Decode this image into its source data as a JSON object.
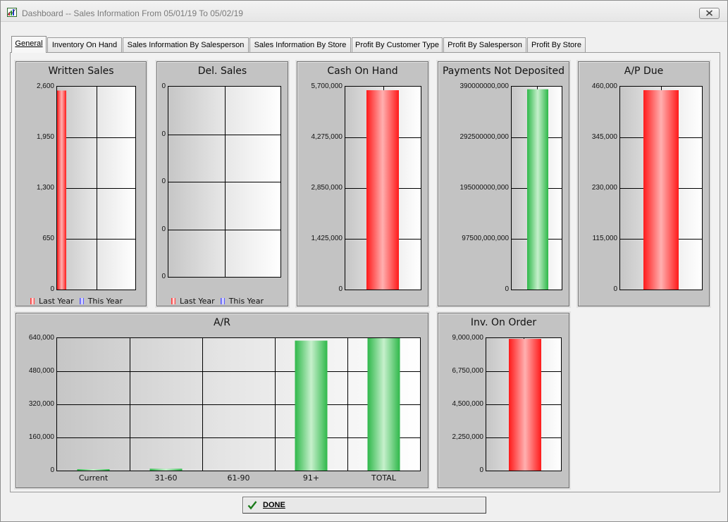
{
  "window": {
    "title": "Dashboard -- Sales Information From 05/01/19 To 05/02/19",
    "app_icon": "chart-icon",
    "close_icon": "close-icon"
  },
  "tabs": [
    {
      "label": "General",
      "active": true
    },
    {
      "label": "Inventory On Hand",
      "active": false
    },
    {
      "label": "Sales Information By Salesperson",
      "active": false
    },
    {
      "label": "Sales Information By Store",
      "active": false
    },
    {
      "label": "Profit By Customer Type",
      "active": false
    },
    {
      "label": "Profit By Salesperson",
      "active": false
    },
    {
      "label": "Profit By Store",
      "active": false
    }
  ],
  "colors": {
    "red_bar": "#ff1a1a",
    "green_bar": "#2fb84a",
    "blue_legend": "#3a3aff",
    "panel_bg": "#c3c3c3"
  },
  "done_button": {
    "label": "DONE",
    "icon": "checkmark-icon"
  },
  "chart_data": [
    {
      "id": "written",
      "type": "bar",
      "title": "Written Sales",
      "yticks": [
        "0",
        "650",
        "1,300",
        "1,950",
        "2,600"
      ],
      "ylim": [
        0,
        2600
      ],
      "categories": [
        ""
      ],
      "series": [
        {
          "name": "Last Year",
          "color": "red",
          "values": [
            2550
          ]
        },
        {
          "name": "This Year",
          "color": "blue",
          "values": [
            0
          ]
        }
      ],
      "legend": [
        "Last Year",
        "This Year"
      ],
      "grid": true,
      "legend_position": "bottom"
    },
    {
      "id": "delsales",
      "type": "bar",
      "title": "Del. Sales",
      "yticks": [
        "0",
        "0",
        "0",
        "0",
        "0"
      ],
      "ylim": [
        0,
        0
      ],
      "categories": [
        ""
      ],
      "series": [
        {
          "name": "Last Year",
          "color": "red",
          "values": [
            0
          ]
        },
        {
          "name": "This Year",
          "color": "blue",
          "values": [
            0
          ]
        }
      ],
      "legend": [
        "Last Year",
        "This Year"
      ],
      "grid": true,
      "legend_position": "bottom"
    },
    {
      "id": "cash",
      "type": "bar",
      "title": "Cash On Hand",
      "yticks": [
        "0",
        "1,425,000",
        "2,850,000",
        "4,275,000",
        "5,700,000"
      ],
      "ylim": [
        0,
        5700000
      ],
      "categories": [
        ""
      ],
      "series": [
        {
          "color": "red",
          "values": [
            5600000
          ]
        }
      ],
      "grid": true
    },
    {
      "id": "payments",
      "type": "bar",
      "title": "Payments Not Deposited",
      "yticks": [
        "0",
        "97500,000,000",
        "195000000,000",
        "292500000,000",
        "390000000,000"
      ],
      "ylim": [
        0,
        390000000000
      ],
      "categories": [
        ""
      ],
      "series": [
        {
          "color": "green",
          "values": [
            385000000000
          ]
        }
      ],
      "grid": true
    },
    {
      "id": "ap",
      "type": "bar",
      "title": "A/P Due",
      "yticks": [
        "0",
        "115,000",
        "230,000",
        "345,000",
        "460,000"
      ],
      "ylim": [
        0,
        460000
      ],
      "categories": [
        ""
      ],
      "series": [
        {
          "color": "red",
          "values": [
            452000
          ]
        }
      ],
      "grid": true
    },
    {
      "id": "ar",
      "type": "bar",
      "title": "A/R",
      "yticks": [
        "0",
        "160,000",
        "320,000",
        "480,000",
        "640,000"
      ],
      "ylim": [
        0,
        640000
      ],
      "categories": [
        "Current",
        "31-60",
        "61-90",
        "91+",
        "TOTAL"
      ],
      "series": [
        {
          "color": "green",
          "values": [
            4000,
            9000,
            0,
            628000,
            640000
          ]
        }
      ],
      "grid": true
    },
    {
      "id": "inv",
      "type": "bar",
      "title": "Inv. On Order",
      "yticks": [
        "0",
        "2,250,000",
        "4,500,000",
        "6,750,000",
        "9,000,000"
      ],
      "ylim": [
        0,
        9000000
      ],
      "categories": [
        ""
      ],
      "series": [
        {
          "color": "red",
          "values": [
            8950000
          ]
        }
      ],
      "grid": true
    }
  ]
}
